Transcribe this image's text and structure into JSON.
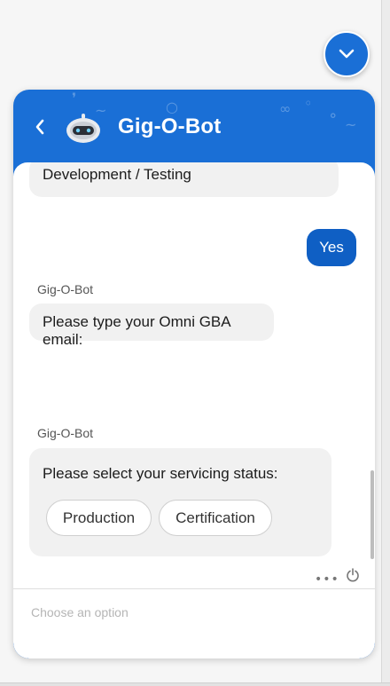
{
  "bot": {
    "name": "Gig-O-Bot"
  },
  "messages": {
    "partial_option": "Development / Testing",
    "user_reply": "Yes",
    "sender_1": "Gig-O-Bot",
    "email_prompt": "Please type your Omni GBA email:",
    "sender_2": "Gig-O-Bot",
    "status_prompt": "Please select your servicing status:"
  },
  "options": [
    "Production",
    "Certification"
  ],
  "footer": {
    "more_label": "•••"
  },
  "input": {
    "placeholder": "Choose an option"
  },
  "colors": {
    "accent": "#1a6fd6",
    "user_bubble": "#0f5fc4",
    "bot_bubble": "#f1f1f1"
  },
  "icons": {
    "collapse": "chevron-down-icon",
    "back": "chevron-left-icon",
    "power": "power-icon"
  }
}
